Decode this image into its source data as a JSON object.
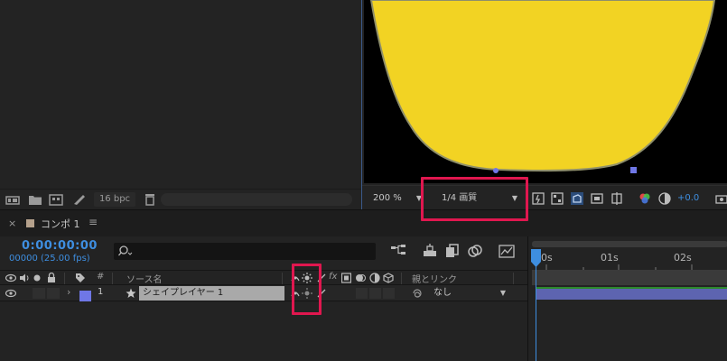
{
  "project_panel": {
    "bpc": "16 bpc"
  },
  "viewer": {
    "zoom": "200 %",
    "resolution": "1/4 画質",
    "exposure": "+0.0",
    "shape_fill_color": "#f2d323"
  },
  "timeline": {
    "tab": {
      "close": "×",
      "comp_name": "コンポ 1",
      "menu": "≡"
    },
    "timecode": "0:00:00:00",
    "frame_info": "00000 (25.00 fps)",
    "search_placeholder": "",
    "columns": {
      "hash": "#",
      "source_name": "ソース名",
      "fx": "fx",
      "parent_link": "親とリンク"
    },
    "layer": {
      "index": "1",
      "name": "シェイプレイヤー 1",
      "label_color": "#6f77e6",
      "parent": "なし"
    },
    "ruler": {
      "labels": [
        "0s",
        "01s",
        "02s"
      ]
    },
    "colors": {
      "accent": "#3e8ee0",
      "layer_bar": "#5d64b0",
      "highlight": "#e0174f"
    }
  }
}
